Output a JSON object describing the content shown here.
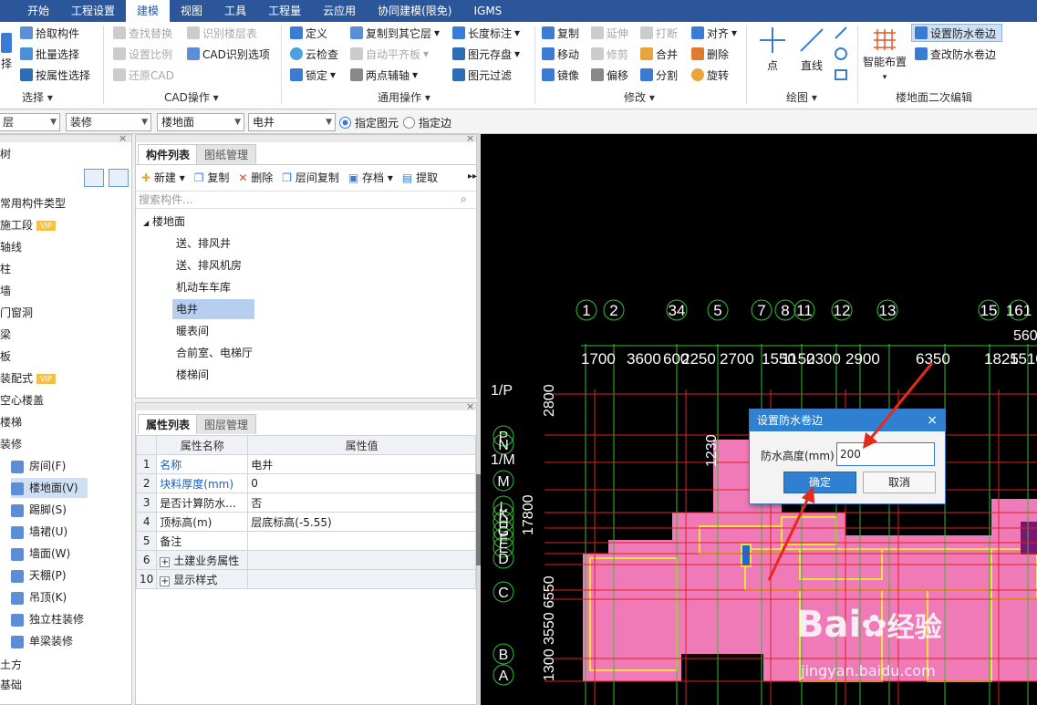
{
  "menu": [
    "开始",
    "工程设置",
    "建模",
    "视图",
    "工具",
    "工程量",
    "云应用",
    "协同建模(限免)",
    "IGMS"
  ],
  "menu_active_index": 2,
  "ribbon": {
    "select_group": {
      "label": "选择",
      "items": [
        "拾取构件",
        "批量选择",
        "按属性选择"
      ],
      "cut_label": "择"
    },
    "cad_group": {
      "label": "CAD操作",
      "items": [
        "查找替换",
        "识别楼层表",
        "设置比例",
        "CAD识别选项",
        "还原CAD"
      ]
    },
    "general_group": {
      "label": "通用操作",
      "items": [
        "定义",
        "复制到其它层",
        "长度标注",
        "云检查",
        "自动平齐板",
        "图元存盘",
        "锁定",
        "两点辅轴",
        "图元过滤"
      ]
    },
    "modify_group": {
      "label": "修改",
      "items": [
        "复制",
        "延伸",
        "打断",
        "对齐",
        "移动",
        "修剪",
        "合并",
        "删除",
        "镜像",
        "偏移",
        "分割",
        "旋转"
      ]
    },
    "draw_group": {
      "label": "绘图",
      "items": [
        "点",
        "直线"
      ]
    },
    "floor_group": {
      "label": "楼地面二次编辑",
      "items": [
        "智能布置",
        "设置防水卷边",
        "查改防水卷边"
      ]
    }
  },
  "filterbar": {
    "floor": "层",
    "category": "装修",
    "type": "楼地面",
    "item": "电井",
    "radio1": "指定图元",
    "radio2": "指定边"
  },
  "left_tree": {
    "title": "树",
    "items": [
      {
        "label": "常用构件类型"
      },
      {
        "label": "施工段",
        "vip": "VIP"
      },
      {
        "label": "轴线"
      },
      {
        "label": "柱"
      },
      {
        "label": "墙"
      },
      {
        "label": "门窗洞"
      },
      {
        "label": "梁"
      },
      {
        "label": "板"
      },
      {
        "label": "装配式",
        "vip": "VIP"
      },
      {
        "label": "空心楼盖"
      },
      {
        "label": "楼梯"
      },
      {
        "label": "装修"
      }
    ],
    "sub_items": [
      {
        "label": "房间(F)",
        "icon": "house-icon"
      },
      {
        "label": "楼地面(V)",
        "icon": "floor-icon",
        "selected": true
      },
      {
        "label": "踢脚(S)",
        "icon": "skirting-icon"
      },
      {
        "label": "墙裙(U)",
        "icon": "wainscot-icon"
      },
      {
        "label": "墙面(W)",
        "icon": "wall-face-icon"
      },
      {
        "label": "天棚(P)",
        "icon": "ceiling-icon"
      },
      {
        "label": "吊顶(K)",
        "icon": "suspended-ceiling-icon"
      },
      {
        "label": "独立柱装修",
        "icon": "column-finish-icon"
      },
      {
        "label": "单梁装修",
        "icon": "beam-finish-icon"
      }
    ],
    "tail_items": [
      {
        "label": "土方"
      },
      {
        "label": "基础"
      }
    ]
  },
  "component_panel": {
    "tabs": [
      "构件列表",
      "图纸管理"
    ],
    "toolbar": [
      "新建",
      "复制",
      "删除",
      "层间复制",
      "存档",
      "提取"
    ],
    "search_placeholder": "搜索构件...",
    "root": "楼地面",
    "items": [
      "送、排风井",
      "送、排风机房",
      "机动车车库",
      "电井",
      "暖表间",
      "合前室、电梯厅",
      "楼梯间"
    ],
    "selected": "电井"
  },
  "property_panel": {
    "tabs": [
      "属性列表",
      "图层管理"
    ],
    "headers": [
      "属性名称",
      "属性值"
    ],
    "rows": [
      {
        "no": "1",
        "name": "名称",
        "value": "电井",
        "blue": true
      },
      {
        "no": "2",
        "name": "块料厚度(mm)",
        "value": "0",
        "blue": true
      },
      {
        "no": "3",
        "name": "是否计算防水...",
        "value": "否"
      },
      {
        "no": "4",
        "name": "顶标高(m)",
        "value": "层底标高(-5.55)"
      },
      {
        "no": "5",
        "name": "备注",
        "value": ""
      },
      {
        "no": "6",
        "name": "土建业务属性",
        "value": "",
        "expand": "+"
      },
      {
        "no": "10",
        "name": "显示样式",
        "value": "",
        "expand": "+"
      }
    ]
  },
  "cad": {
    "axis_numbers": [
      "1",
      "2",
      "34",
      "5",
      "7",
      "8",
      "11",
      "12",
      "13",
      "15",
      "161"
    ],
    "axis_numbers_secondary": [
      "560"
    ],
    "dims_top": [
      "1700",
      "3600",
      "600",
      "2250",
      "2700",
      "1550",
      "1150",
      "2300",
      "2900",
      "6350",
      "1825",
      "1510"
    ],
    "axis_letters": [
      "1/P",
      "P",
      "N",
      "1/M",
      "M",
      "L",
      "K",
      "H",
      "G",
      "F",
      "E",
      "D",
      "C",
      "B",
      "A"
    ],
    "dims_left": [
      "17800",
      "1300",
      "3550",
      "6550",
      "2800",
      "1230"
    ],
    "colors": {
      "background": "#000000",
      "room": "#f07ab8",
      "grid": "#e02020",
      "axis": "#30c030",
      "wall": "#f0e040"
    }
  },
  "dialog": {
    "title": "设置防水卷边",
    "label": "防水高度(mm)",
    "value": "200",
    "ok": "确定",
    "cancel": "取消",
    "close": "×"
  },
  "watermark": {
    "brand": "Bai",
    "brand2": "经验",
    "url": "jingyan.baidu.com"
  }
}
